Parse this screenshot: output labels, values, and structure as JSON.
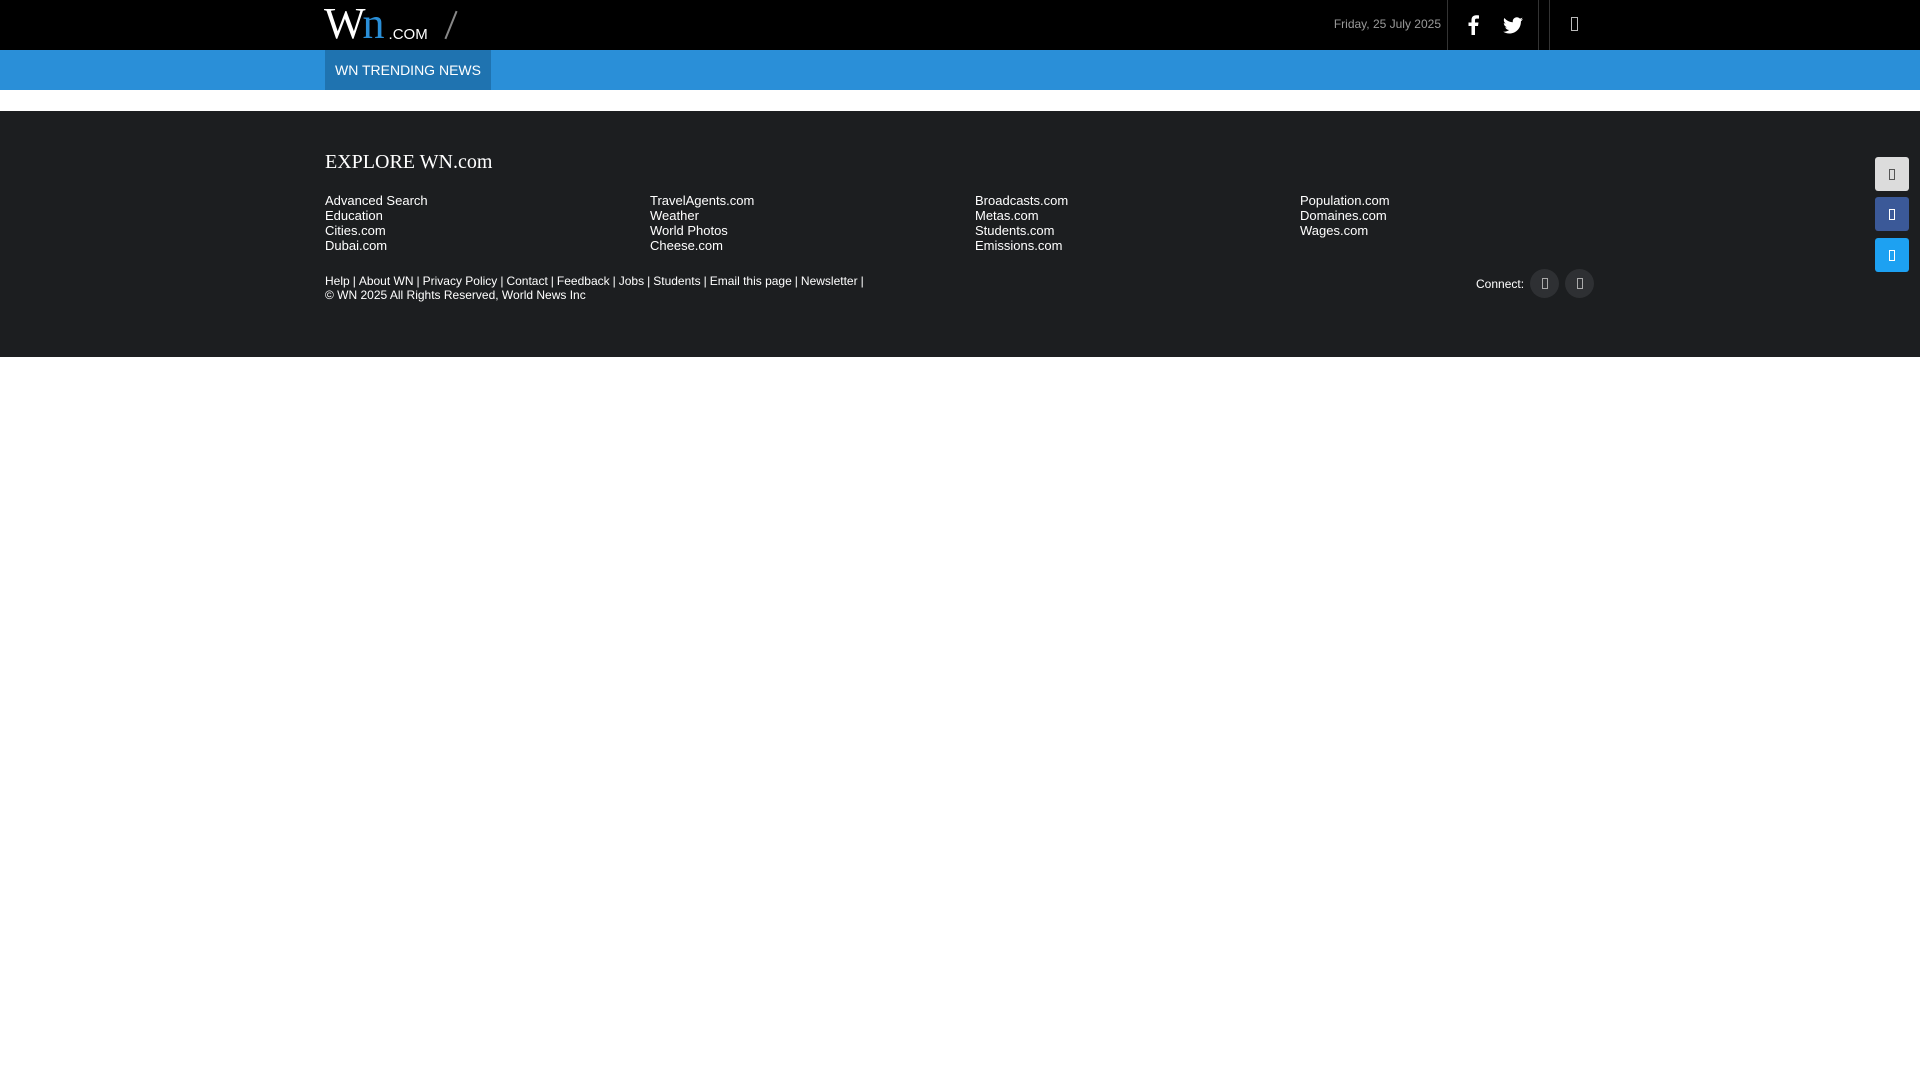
{
  "header": {
    "logo": {
      "main": "Wn",
      "w": "W",
      "n": "n",
      "suffix": ".COM"
    },
    "date": "Friday, 25 July 2025",
    "icons": [
      "facebook-icon",
      "twitter-icon",
      "menu-icon"
    ]
  },
  "nav": {
    "tabs": [
      {
        "label": "WN TRENDING NEWS"
      }
    ]
  },
  "explore": {
    "title": "EXPLORE WN.com",
    "columns": [
      [
        "Advanced Search",
        "Education",
        "Cities.com",
        "Dubai.com"
      ],
      [
        "TravelAgents.com",
        "Weather",
        "World Photos",
        "Cheese.com"
      ],
      [
        "Broadcasts.com",
        "Metas.com",
        "Students.com",
        "Emissions.com"
      ],
      [
        "Population.com",
        "Domaines.com",
        "Wages.com"
      ]
    ]
  },
  "footer": {
    "links": [
      "Help",
      "About WN",
      "Privacy Policy",
      "Contact",
      "Feedback",
      "Jobs",
      "Students",
      "Email this page",
      "Newsletter"
    ],
    "separator": "|",
    "copyright": "© WN 2025 All Rights Reserved, World News Inc",
    "connect_label": "Connect:"
  },
  "colors": {
    "topbar": "#000000",
    "nav": "#2a8fd8",
    "nav_active": "#1f73b0",
    "footer": "#1c1e20",
    "facebook": "#3b5998",
    "twitter": "#1da1f2"
  }
}
